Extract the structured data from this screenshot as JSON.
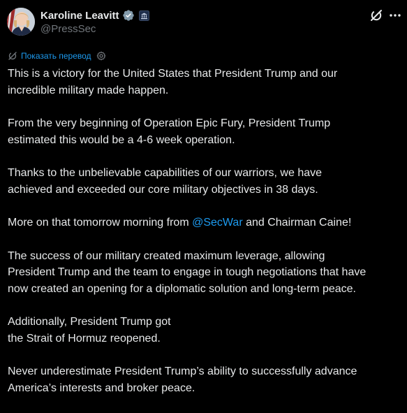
{
  "author": {
    "display_name": "Karoline Leavitt",
    "handle": "@PressSec"
  },
  "translate": {
    "label": "Показать перевод"
  },
  "post": {
    "p1": "This is a victory for the United States that President Trump and our\nincredible military made happen.",
    "p2": "From the very beginning of Operation Epic Fury, President Trump\nestimated this would be a 4-6 week operation.",
    "p3": "Thanks to the unbelievable capabilities of our warriors, we have\nachieved and exceeded our core military objectives in 38 days.",
    "p4_before": "More on that tomorrow morning from ",
    "p4_mention": "@SecWar",
    "p4_after": " and Chairman Caine!",
    "p5": "The success of our military created maximum leverage, allowing\nPresident Trump and the team to engage in tough negotiations that have\nnow created an opening for a diplomatic solution and long-term peace.",
    "p6": "Additionally, President Trump got\nthe Strait of Hormuz reopened.",
    "p7": "Never underestimate President Trump’s ability to successfully advance\nAmerica’s interests and broker peace."
  },
  "icons": {
    "verified": "verified-badge-icon",
    "government": "government-badge-icon",
    "grok": "grok-icon",
    "more": "more-options-icon",
    "translate": "translate-icon",
    "settings": "gear-icon"
  },
  "colors": {
    "background": "#000000",
    "text": "#e7e9ea",
    "secondary_text": "#71767b",
    "link": "#1d9bf0",
    "verified": "#829aab"
  }
}
